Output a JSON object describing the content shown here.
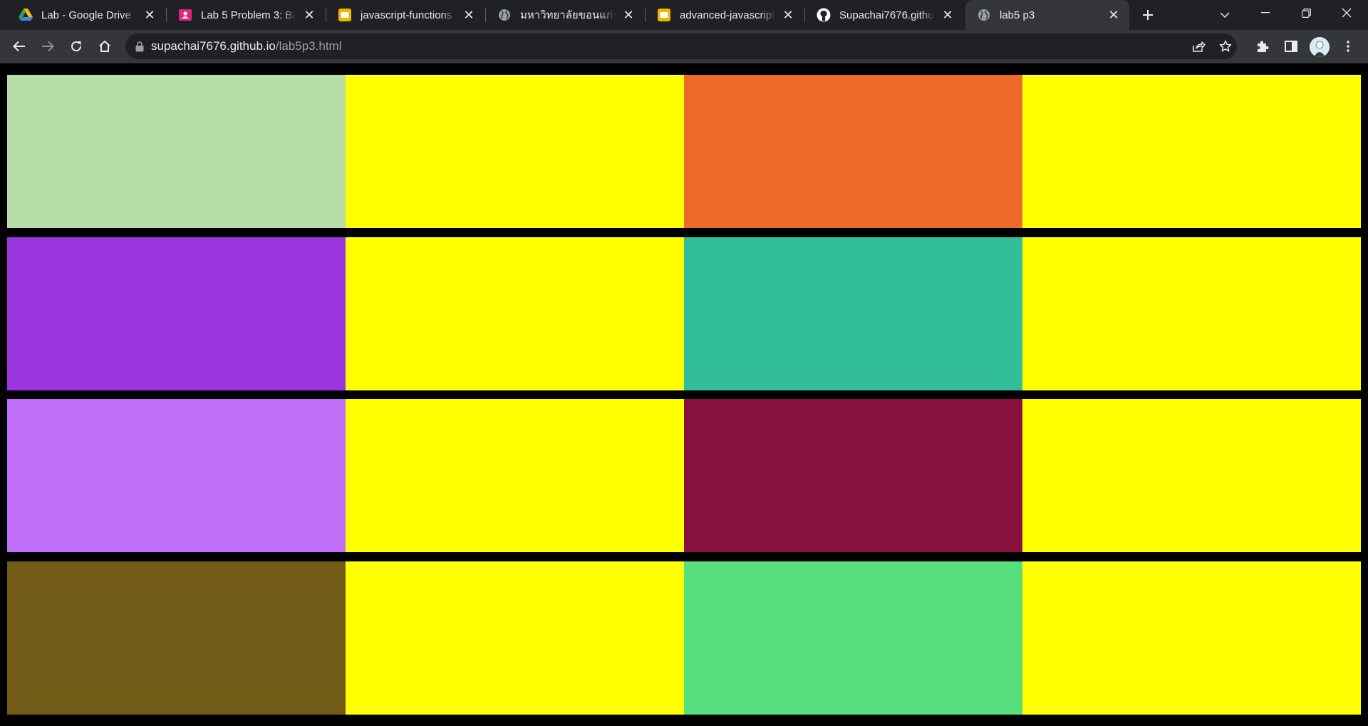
{
  "tabs": [
    {
      "title": "Lab - Google Drive",
      "favicon": "google-drive-icon"
    },
    {
      "title": "Lab 5 Problem 3: Background",
      "favicon": "classroom-icon"
    },
    {
      "title": "javascript-functions - Google Slides",
      "favicon": "slides-icon"
    },
    {
      "title": "มหาวิทยาลัยขอนแก่น",
      "favicon": "globe-icon"
    },
    {
      "title": "advanced-javascript - Google Slides",
      "favicon": "slides-icon"
    },
    {
      "title": "Supachai7676.github.io",
      "favicon": "github-icon"
    },
    {
      "title": "lab5 p3",
      "favicon": "globe-icon",
      "active": true
    }
  ],
  "address_bar": {
    "host": "supachai7676.github.io",
    "path": "/lab5p3.html"
  },
  "colors": {
    "page_background": "#000000",
    "chrome_frame": "#202124",
    "chrome_toolbar": "#35363a"
  },
  "grid": {
    "rows": [
      [
        "#b6dea6",
        "#ffff00",
        "#ec6a2a",
        "#ffff00"
      ],
      [
        "#9a35e0",
        "#ffff00",
        "#32be98",
        "#ffff00"
      ],
      [
        "#bf6ef8",
        "#ffff00",
        "#87113e",
        "#ffff00"
      ],
      [
        "#725b16",
        "#ffff00",
        "#57df7e",
        "#ffff00"
      ]
    ]
  }
}
